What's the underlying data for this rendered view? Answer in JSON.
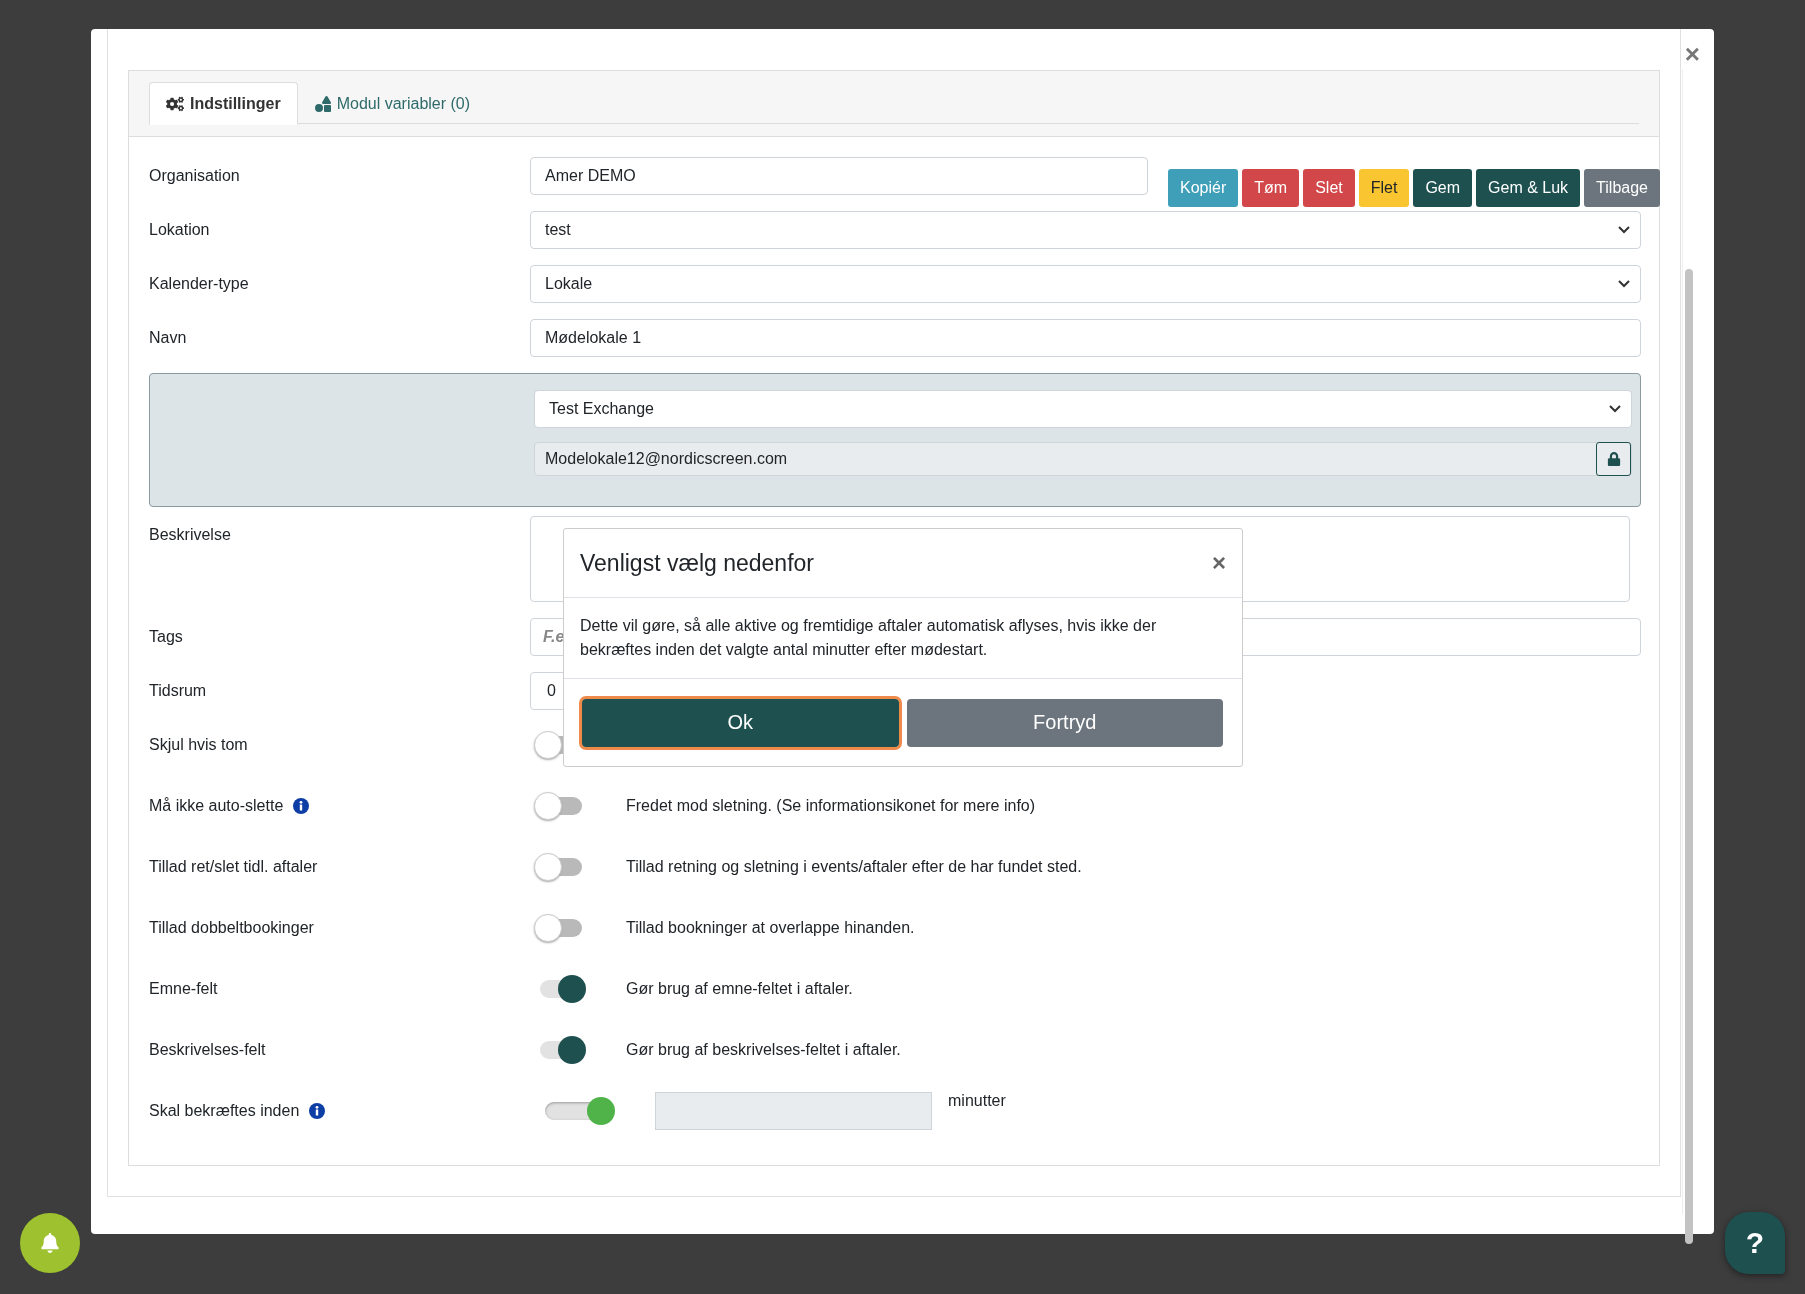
{
  "modal_close": "×",
  "tabs": [
    {
      "label": "Indstillinger",
      "selected": true
    },
    {
      "label": "Modul variabler (0)",
      "selected": false
    }
  ],
  "actions": [
    {
      "label": "Kopiér",
      "color": "#3f9fb8"
    },
    {
      "label": "Tøm",
      "color": "#d1474a"
    },
    {
      "label": "Slet",
      "color": "#d1474a"
    },
    {
      "label": "Flet",
      "color": "#f9c631"
    },
    {
      "label": "Gem",
      "color": "#1f5050"
    },
    {
      "label": "Gem & Luk",
      "color": "#1f5050"
    },
    {
      "label": "Tilbage",
      "color": "#6c757d"
    }
  ],
  "fields": [
    {
      "kind": "text",
      "label": "Organisation",
      "value": "Amer DEMO"
    },
    {
      "kind": "select",
      "label": "Lokation",
      "value": "test"
    },
    {
      "kind": "select",
      "label": "Kalender-type",
      "value": "Lokale"
    },
    {
      "kind": "text",
      "label": "Navn",
      "value": "Mødelokale 1"
    }
  ],
  "exchange": {
    "calendar": "Test Exchange",
    "email": "Modelokale12@nordicscreen.com"
  },
  "description": {
    "label": "Beskrivelse"
  },
  "tags": {
    "label": "Tags",
    "placeholder": "F.e"
  },
  "period": {
    "label": "Tidsrum",
    "value": "0"
  },
  "toggles": [
    {
      "kind": "switch",
      "label": "Skjul hvis tom",
      "on": false,
      "info": false
    },
    {
      "kind": "switch",
      "label": "Må ikke auto-slette",
      "on": false,
      "info": true,
      "text": "Fredet mod sletning. (Se informationsikonet for mere info)"
    },
    {
      "kind": "switch",
      "label": "Tillad ret/slet tidl. aftaler",
      "on": false,
      "info": false,
      "text": "Tillad retning og sletning i events/aftaler efter de har fundet sted."
    },
    {
      "kind": "switch",
      "label": "Tillad dobbeltbookinger",
      "on": false,
      "info": false,
      "text": "Tillad bookninger at overlappe hinanden."
    },
    {
      "kind": "switch",
      "label": "Emne-felt",
      "on": true,
      "info": false,
      "text": "Gør brug af emne-feltet i aftaler."
    },
    {
      "kind": "switch",
      "label": "Beskrivelses-felt",
      "on": true,
      "info": false,
      "text": "Gør brug af beskrivelses-feltet i aftaler."
    },
    {
      "kind": "minutes",
      "label": "Skal bekræftes inden",
      "on": true,
      "info": true,
      "unit": "minutter"
    }
  ],
  "dialog": {
    "title": "Venligst vælg nedenfor",
    "close": "×",
    "body": "Dette vil gøre, så alle aktive og fremtidige aftaler automatisk aflyses, hvis ikke der bekræftes inden det valgte antal minutter efter mødestart.",
    "buttons": [
      {
        "label": "Ok",
        "kind": "primary",
        "focused": true
      },
      {
        "label": "Fortryd",
        "kind": "secondary",
        "focused": false
      }
    ]
  },
  "help": "?"
}
